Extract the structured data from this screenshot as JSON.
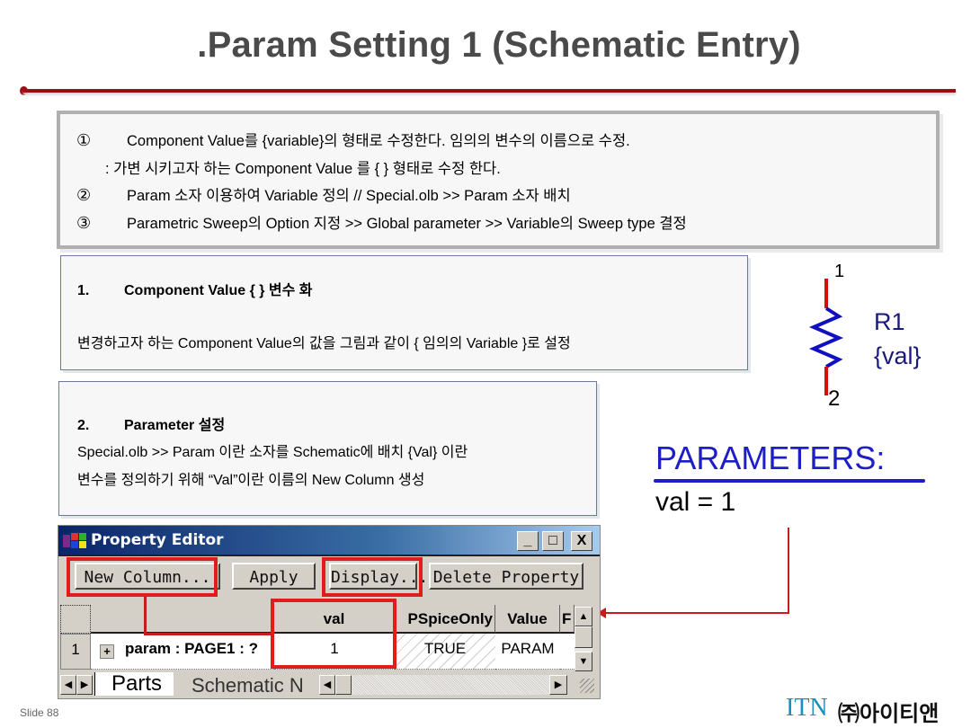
{
  "title": ".Param Setting 1 (Schematic Entry)",
  "summary": {
    "lines": [
      {
        "num": "①",
        "text": "Component Value를 {variable}의 형태로 수정한다. 임의의 변수의 이름으로 수정."
      },
      {
        "num": "",
        "text": ": 가변 시키고자 하는 Component Value 를 { } 형태로 수정 한다."
      },
      {
        "num": "②",
        "text": "Param 소자 이용하여 Variable 정의 // Special.olb >> Param 소자 배치"
      },
      {
        "num": "③",
        "text": "Parametric Sweep의 Option 지정 >> Global parameter >> Variable의 Sweep type 결정"
      }
    ]
  },
  "step1": {
    "num": "1.",
    "heading": "Component Value {   } 변수 화",
    "text": "변경하고자 하는 Component  Value의 값을 그림과 같이 { 임의의 Variable }로 설정"
  },
  "step2": {
    "num": "2.",
    "heading": "Parameter 설정",
    "line1": "Special.olb >> Param 이란 소자를 Schematic에 배치 {Val} 이란",
    "line2": "변수를 정의하기 위해 “Val”이란 이름의 New Column 생성"
  },
  "resistor": {
    "pin1": "1",
    "pin2": "2",
    "ref": "R1",
    "value": "{val}",
    "lead_color": "#d01010",
    "body_color": "#1010c0"
  },
  "parameters": {
    "title": "PARAMETERS:",
    "value_line": "val = 1"
  },
  "property_editor": {
    "title": "Property Editor",
    "window_buttons": {
      "minimize": "_",
      "maximize": "□",
      "close": "X"
    },
    "toolbar": {
      "new_column": "New Column...",
      "apply": "Apply",
      "display": "Display...",
      "delete_property": "Delete Property"
    },
    "columns": [
      "val",
      "PSpiceOnly",
      "Value",
      "F"
    ],
    "rows": [
      {
        "index": "1",
        "name": "param : PAGE1 : ?",
        "expand": "+",
        "val": "1",
        "pspiceonly": "TRUE",
        "value": "PARAM"
      }
    ],
    "tabs": [
      "Parts",
      "Schematic N"
    ]
  },
  "footer": {
    "slide": "Slide 88",
    "logo": "ITN",
    "company": "㈜아이티앤"
  },
  "colors": {
    "accent_red": "#9b0f14",
    "highlight_red": "#e21b1b",
    "param_blue": "#1e1ec8"
  }
}
